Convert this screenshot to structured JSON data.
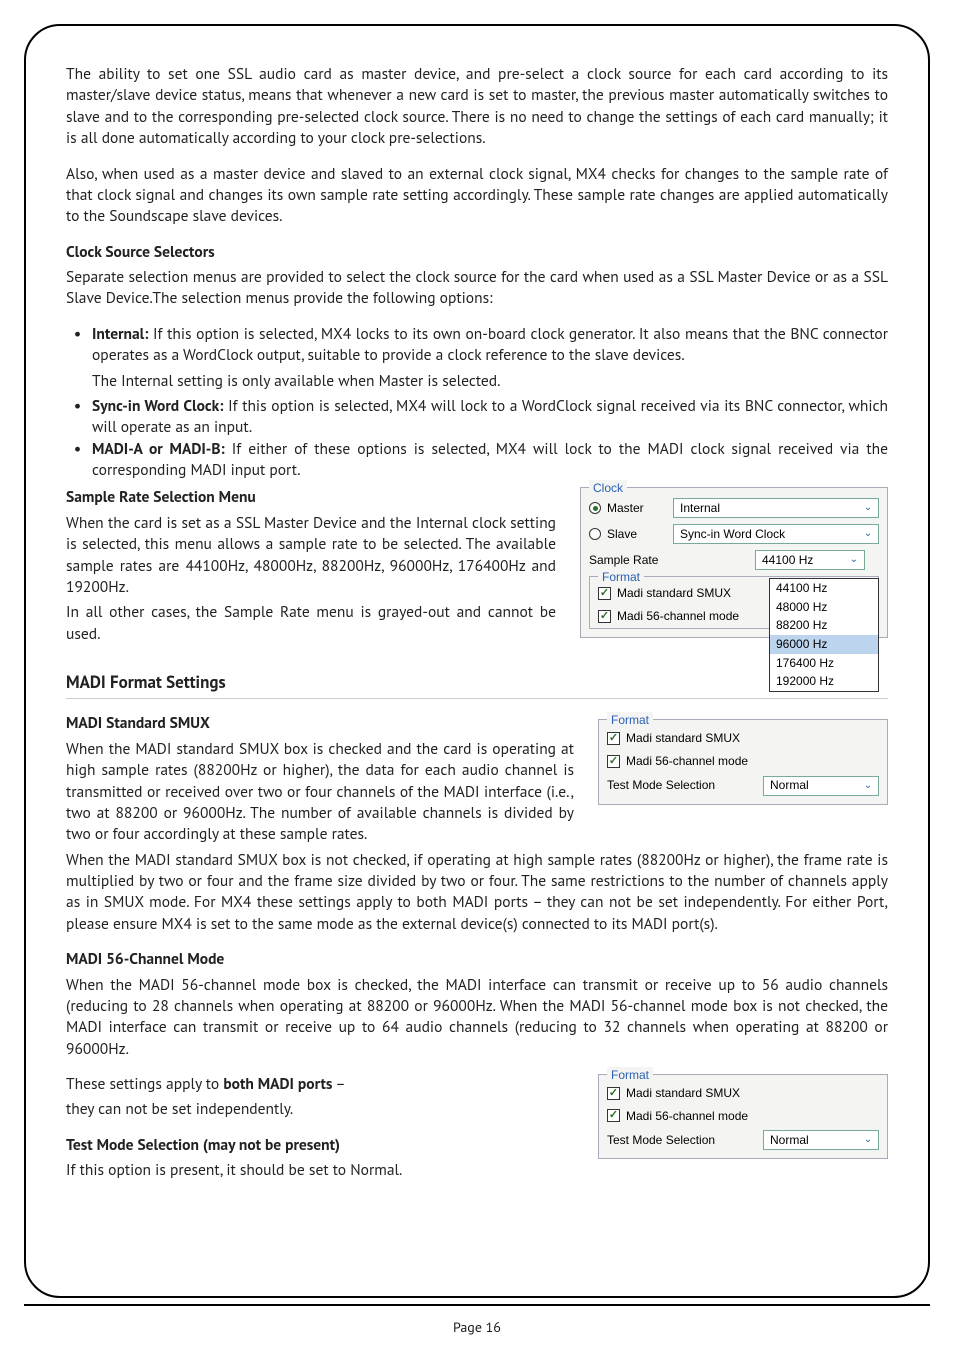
{
  "para1": "The ability to set one SSL audio card as master device, and pre-select a clock source for each card according to its master/slave device status, means that whenever a new card is set to master, the previous master automatically switches to slave and to the corresponding pre-selected clock source. There is no need to change the settings of each card manually; it is all done automatically according to your clock pre-selections.",
  "para2": "Also, when used as a master device and slaved to an external clock signal, MX4 checks for changes to the sample rate of that clock signal and changes its own sample rate setting accordingly. These sample rate changes are applied automatically to the Soundscape slave devices.",
  "clock_sel_heading": "Clock Source Selectors",
  "clock_sel_body": "Separate selection menus are provided to select the clock source for the card when used as a SSL Master Device or as a SSL Slave Device.The selection menus provide the following options:",
  "opt_internal_label": "Internal:",
  "opt_internal_body": " If this option is selected, MX4 locks to its own on-board clock generator. It also means that the BNC connector operates as a WordClock output, suitable to provide a clock reference to the slave devices.",
  "opt_internal_sub": "The Internal setting is only available when Master is selected.",
  "opt_sync_label": "Sync-in Word Clock:",
  "opt_sync_body": " If this option is selected, MX4 will lock to a WordClock signal received via its BNC connector, which will operate as an input.",
  "opt_madi_label": "MADI-A or MADI-B:",
  "opt_madi_body": " If either of these options is selected, MX4 will lock to the MADI clock signal received via the corresponding MADI input port.",
  "sr_heading": "Sample Rate Selection Menu",
  "sr_body1": "When the card is set as a SSL Master Device and the Internal clock setting is selected, this menu allows a sample rate to be selected. The available sample rates are 44100Hz, 48000Hz, 88200Hz, 96000Hz, 176400Hz and 19200Hz.",
  "sr_body2": "In all other cases, the Sample Rate menu is grayed-out and cannot be used.",
  "madi_section": "MADI Format Settings",
  "smux_heading": "MADI Standard SMUX",
  "smux_body1": "When the MADI standard SMUX box is checked and the card is operating at high sample rates (88200Hz or higher), the data for each audio channel is transmitted or received over two or four channels of the MADI interface (i.e., two at 88200 or 96000Hz. The number of available channels is divided by two or four accordingly at these sample rates.",
  "smux_body2": "When the MADI standard SMUX box is not checked, if operating at high sample rates (88200Hz or higher), the frame rate is multiplied by two or four and the frame size divided by two or four. The same restrictions to the number of channels apply as in SMUX mode. For MX4 these settings apply to both MADI ports – they can not be set independently. For either Port, please ensure MX4 is set to the same mode as the external device(s) connected to its MADI port(s).",
  "m56_heading": "MADI 56-Channel Mode",
  "m56_body": "When the MADI 56-channel mode box is checked, the MADI interface can transmit or receive up to 56 audio channels (reducing to 28 channels when operating at 88200 or 96000Hz. When the MADI 56-channel mode box is not checked, the MADI interface can transmit or receive up to 64 audio channels (reducing to 32 channels when operating at 88200 or 96000Hz.",
  "both_ports_pre": "These settings apply to ",
  "both_ports_bold": "both MADI ports",
  "both_ports_post": " –",
  "both_ports_line2": "they can not be set independently.",
  "test_heading": "Test Mode Selection (may not be present)",
  "test_body": "If this option is present, it should be set to Normal.",
  "footer": "Page 16",
  "panel_clock": {
    "legend": "Clock",
    "master": "Master",
    "slave": "Slave",
    "master_sel": "Internal",
    "slave_sel": "Sync-in Word Clock",
    "sr_label": "Sample Rate",
    "sr_val": "44100 Hz",
    "dropdown": [
      "44100 Hz",
      "48000 Hz",
      "88200 Hz",
      "96000 Hz",
      "176400 Hz",
      "192000 Hz"
    ],
    "format_legend": "Format",
    "smux": "Madi standard SMUX",
    "m56": "Madi 56-channel mode"
  },
  "panel_format": {
    "legend": "Format",
    "smux": "Madi standard SMUX",
    "m56": "Madi 56-channel mode",
    "test_label": "Test Mode Selection",
    "test_val": "Normal"
  }
}
